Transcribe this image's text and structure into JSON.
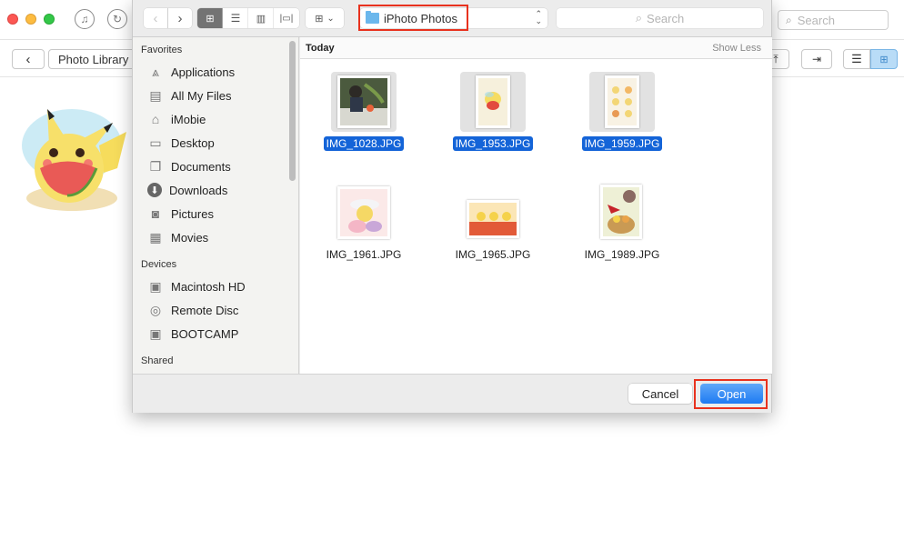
{
  "app": {
    "search_placeholder": "Search",
    "breadcrumb_label": "Photo Library",
    "icons": [
      "music-icon",
      "refresh-icon",
      "back-icon",
      "import-icon",
      "export-icon",
      "list-view-icon",
      "grid-view-icon"
    ]
  },
  "dialog": {
    "location": "iPhoto Photos",
    "search_placeholder": "Search",
    "sidebar": {
      "sections": [
        {
          "title": "Favorites",
          "items": [
            {
              "label": "Applications",
              "icon": "applications-icon"
            },
            {
              "label": "All My Files",
              "icon": "all-files-icon"
            },
            {
              "label": "iMobie",
              "icon": "home-icon"
            },
            {
              "label": "Desktop",
              "icon": "desktop-icon"
            },
            {
              "label": "Documents",
              "icon": "documents-icon"
            },
            {
              "label": "Downloads",
              "icon": "downloads-icon"
            },
            {
              "label": "Pictures",
              "icon": "camera-icon"
            },
            {
              "label": "Movies",
              "icon": "film-icon"
            }
          ]
        },
        {
          "title": "Devices",
          "items": [
            {
              "label": "Macintosh HD",
              "icon": "hard-drive-icon"
            },
            {
              "label": "Remote Disc",
              "icon": "disc-icon"
            },
            {
              "label": "BOOTCAMP",
              "icon": "hard-drive-icon"
            }
          ]
        },
        {
          "title": "Shared",
          "items": []
        }
      ]
    },
    "group": {
      "title": "Today",
      "toggle_label": "Show Less"
    },
    "files": [
      {
        "name": "IMG_1028.JPG",
        "selected": true
      },
      {
        "name": "IMG_1953.JPG",
        "selected": true
      },
      {
        "name": "IMG_1959.JPG",
        "selected": true
      },
      {
        "name": "IMG_1961.JPG",
        "selected": false
      },
      {
        "name": "IMG_1965.JPG",
        "selected": false
      },
      {
        "name": "IMG_1989.JPG",
        "selected": false
      }
    ],
    "buttons": {
      "cancel": "Cancel",
      "open": "Open"
    },
    "colors": {
      "selection": "#1464d8",
      "open_button": "#1e7af3",
      "highlight_box": "#e8321e"
    }
  }
}
